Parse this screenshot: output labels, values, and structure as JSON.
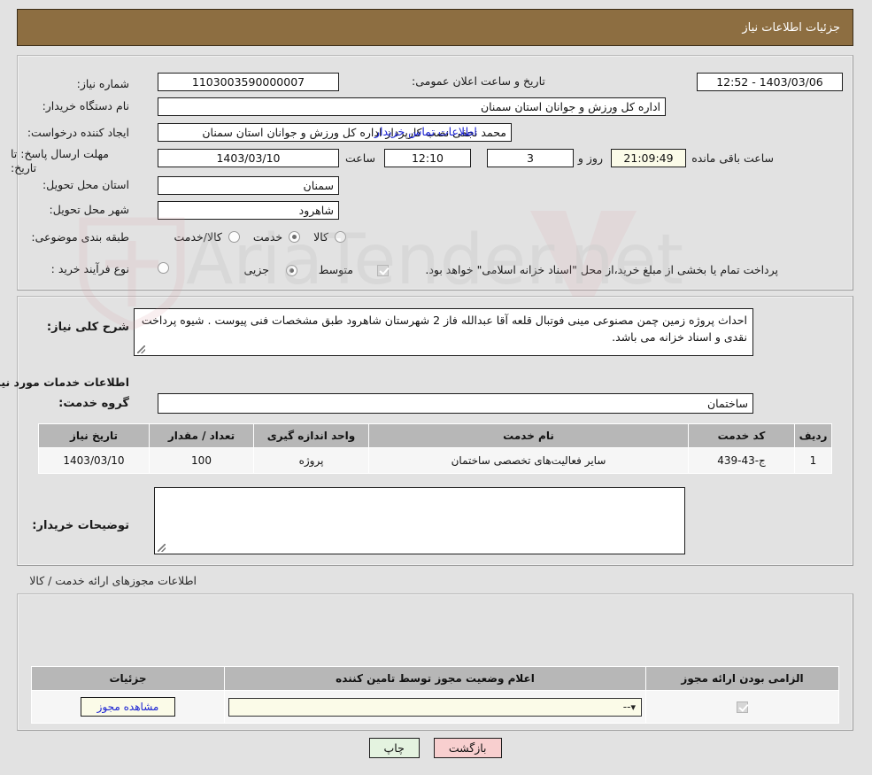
{
  "header": {
    "title": "جزئیات اطلاعات نیاز"
  },
  "top_section": {
    "need_number_label": "شماره نیاز:",
    "need_number_value": "1103003590000007",
    "public_announce_label": "تاریخ و ساعت اعلان عمومی:",
    "public_announce_value": "1403/03/06 - 12:52",
    "buyer_org_label": "نام دستگاه خریدار:",
    "buyer_org_value": "اداره کل ورزش و جوانان استان سمنان",
    "creator_label": "ایجاد کننده درخواست:",
    "creator_value": "محمد نجفی نصب کارپرداز اداره کل ورزش و جوانان استان سمنان",
    "contact_link": "اطلاعات تماس خریدار",
    "deadline_label": "مهلت ارسال پاسخ: تا تاریخ:",
    "deadline_date": "1403/03/10",
    "hour_label": "ساعت",
    "deadline_time": "12:10",
    "days_value": "3",
    "days_label": "روز و",
    "countdown_value": "21:09:49",
    "remaining_label": "ساعت باقی مانده",
    "province_label": "استان محل تحویل:",
    "province_value": "سمنان",
    "city_label": "شهر محل تحویل:",
    "city_value": "شاهرود",
    "category_label": "طبقه بندی موضوعی:",
    "category_options": [
      {
        "label": "کالا",
        "selected": false
      },
      {
        "label": "خدمت",
        "selected": true
      },
      {
        "label": "کالا/خدمت",
        "selected": false
      }
    ],
    "purchase_type_label": "نوع فرآیند خرید :",
    "purchase_type_options": [
      {
        "label": "جزیی",
        "selected": false
      },
      {
        "label": "متوسط",
        "selected": true
      }
    ],
    "treasury_checkbox_checked": true,
    "treasury_note": "پرداخت تمام یا بخشی از مبلغ خرید،از محل \"اسناد خزانه اسلامی\" خواهد بود."
  },
  "mid_section": {
    "general_desc_label": "شرح کلی نیاز:",
    "general_desc_value": "احداث پروژه زمین چمن مصنوعی مینی فوتبال قلعه آقا عبدالله فاز 2 شهرستان شاهرود طبق مشخصات فنی پیوست . شیوه پرداخت نقدی و اسناد خزانه می باشد.",
    "services_info_title": "اطلاعات خدمات مورد نیاز",
    "service_group_label": "گروه خدمت:",
    "service_group_value": "ساختمان",
    "table_headers": [
      "ردیف",
      "کد خدمت",
      "نام خدمت",
      "واحد اندازه گیری",
      "تعداد / مقدار",
      "تاریخ نیاز"
    ],
    "table_rows": [
      {
        "row": "1",
        "code": "ج-43-439",
        "name": "سایر فعالیت‌های تخصصی ساختمان",
        "unit": "پروژه",
        "qty": "100",
        "date": "1403/03/10"
      }
    ],
    "buyer_notes_label": "توضیحات خریدار:",
    "buyer_notes_value": ""
  },
  "permits_section": {
    "title": "اطلاعات مجوزهای ارائه خدمت / کالا",
    "table_headers": [
      "الزامی بودن ارائه مجوز",
      "اعلام وضعیت مجوز توسط تامین کننده",
      "جزئیات"
    ],
    "rows": [
      {
        "required_checked": true,
        "status_value": "--",
        "details_button": "مشاهده مجوز"
      }
    ]
  },
  "footer": {
    "print_label": "چاپ",
    "back_label": "بازگشت"
  },
  "colors": {
    "header_bg": "#8d6e41",
    "page_bg": "#e2e2e2",
    "link": "#1a22d4",
    "back_btn": "#f8cfcf",
    "print_btn": "#e4f3e0",
    "timer_bg": "#fbfbe8",
    "table_header_bg": "#b7b7b7"
  },
  "watermark_text": "AriaTender.net"
}
